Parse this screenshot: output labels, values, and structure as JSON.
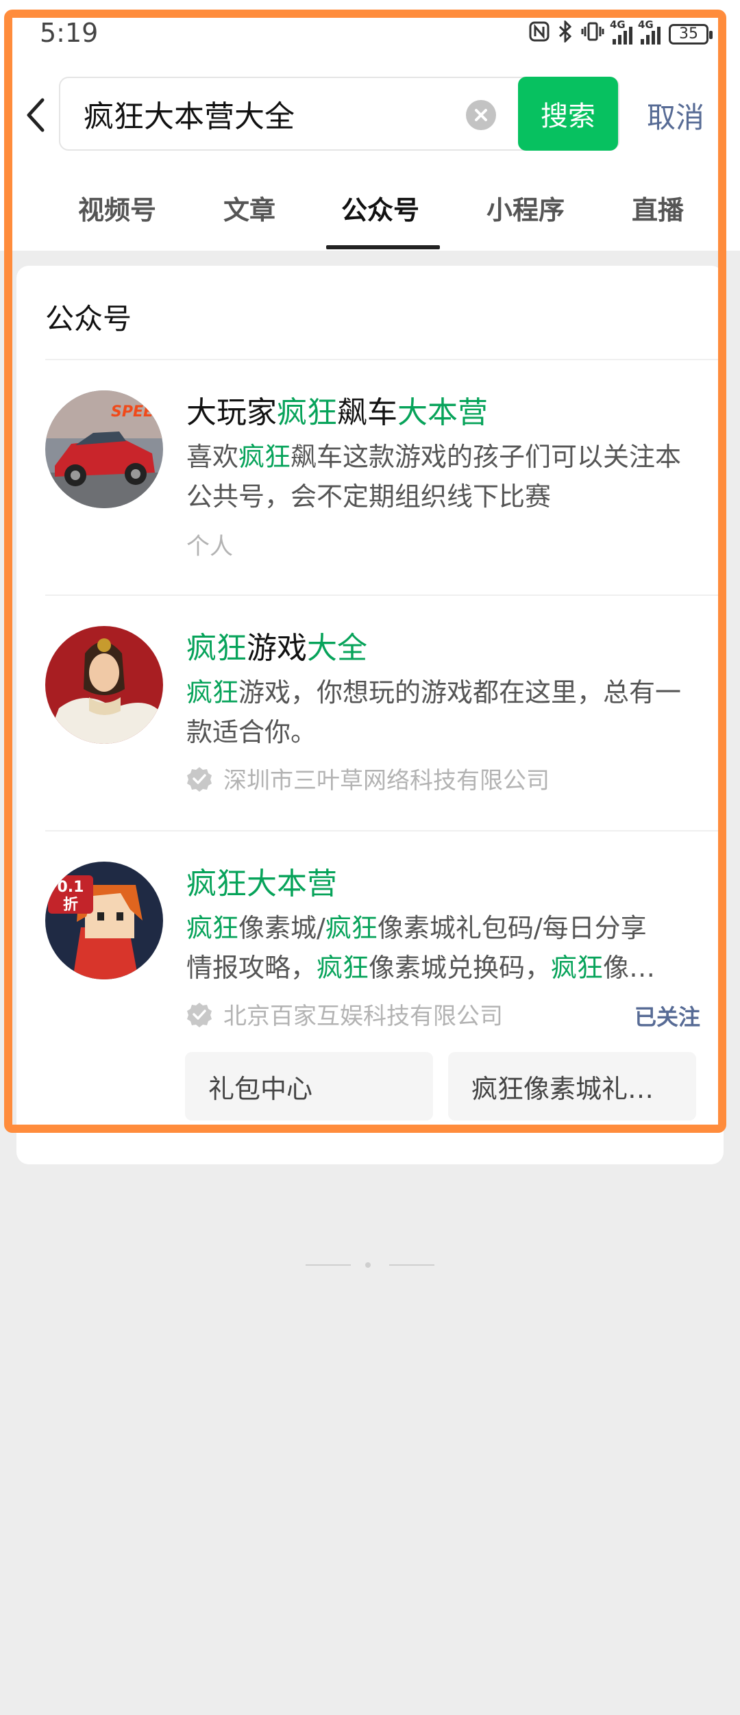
{
  "status_bar": {
    "time": "5:19",
    "network_label": "4G",
    "battery_level": "35"
  },
  "search": {
    "query": "疯狂大本营大全",
    "button_label": "搜索",
    "cancel_label": "取消"
  },
  "tabs": [
    {
      "label": "视频号",
      "active": false
    },
    {
      "label": "文章",
      "active": false
    },
    {
      "label": "公众号",
      "active": true
    },
    {
      "label": "小程序",
      "active": false
    },
    {
      "label": "直播",
      "active": false
    }
  ],
  "section_title": "公众号",
  "results": [
    {
      "title_parts": [
        "大玩家",
        "疯狂",
        "飙车",
        "大本营"
      ],
      "desc_parts": [
        "喜欢",
        "疯狂",
        "飙车这款游戏的孩子们可以关注本公共号，会不定期组织线下比赛"
      ],
      "meta": "个人",
      "verified": false
    },
    {
      "title_parts": [
        "疯狂",
        "游戏",
        "大全"
      ],
      "desc_parts": [
        "疯狂",
        "游戏，你想玩的游戏都在这里，总有一款适合你。"
      ],
      "meta": "深圳市三叶草网络科技有限公司",
      "verified": true
    },
    {
      "title_parts": [
        "疯狂大本营"
      ],
      "desc_line1_parts": [
        "疯狂",
        "像素城/",
        "疯狂",
        "像素城礼包码/每日分享"
      ],
      "desc_line2_parts": [
        "情报攻略，",
        "疯狂",
        "像素城兑换码，",
        "疯狂",
        "像…"
      ],
      "meta": "北京百家互娱科技有限公司",
      "verified": true,
      "followed_label": "已关注",
      "avatar_badge_top": "0.1",
      "avatar_badge_bottom": "折",
      "sub_buttons": [
        "礼包中心",
        "疯狂像素城礼…"
      ]
    }
  ],
  "avatar1_text": "SPEED",
  "colors": {
    "accent_green": "#07c160",
    "highlight_green": "#07a35a",
    "link_blue": "#576b95",
    "annotation_orange": "#ff8c3c"
  }
}
